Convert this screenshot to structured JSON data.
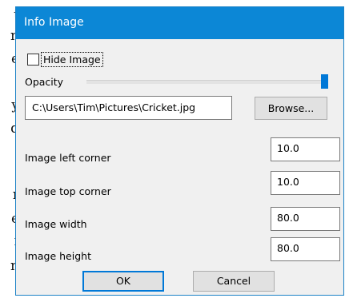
{
  "background_text": [
    "t",
    "n",
    "e",
    ",",
    "y",
    "d",
    "r",
    "e",
    "f",
    "n"
  ],
  "dialog": {
    "title": "Info Image",
    "hide_image": {
      "label": "Hide Image",
      "checked": false
    },
    "opacity": {
      "label": "Opacity",
      "value": 1.0
    },
    "image_path": "C:\\Users\\Tim\\Pictures\\Cricket.jpg",
    "browse_label": "Browse...",
    "fields": [
      {
        "label": "Image left corner",
        "value": "10.0"
      },
      {
        "label": "Image top corner",
        "value": "10.0"
      },
      {
        "label": "Image width",
        "value": "80.0"
      },
      {
        "label": "Image height",
        "value": "80.0"
      }
    ],
    "ok_label": "OK",
    "cancel_label": "Cancel"
  },
  "colors": {
    "titlebar": "#0c87d6",
    "accent": "#0078d7",
    "client_background": "#f0f0f0"
  }
}
